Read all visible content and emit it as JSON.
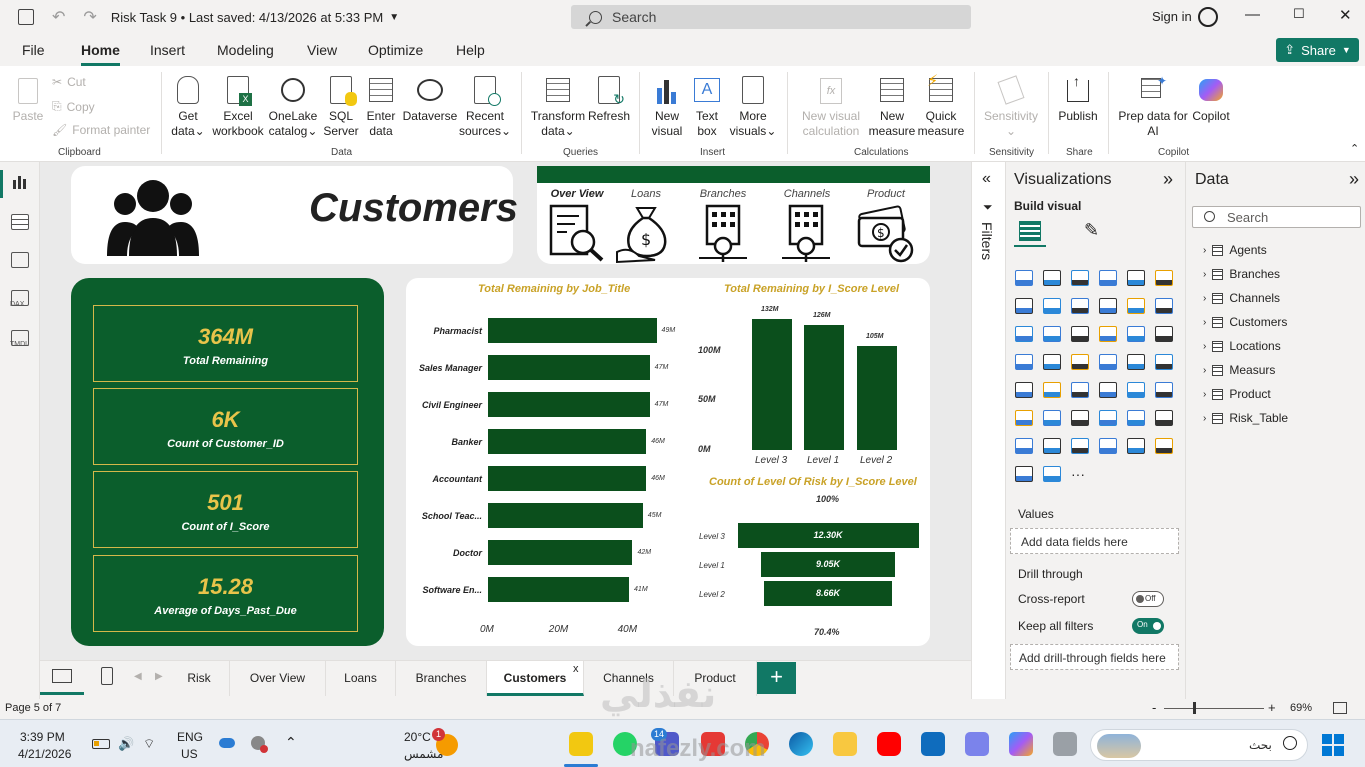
{
  "window": {
    "title": "Risk Task 9",
    "saved": "Last saved: 4/13/2026 at 5:33 PM",
    "search_placeholder": "Search",
    "sign_in": "Sign in"
  },
  "menu": {
    "tabs": [
      "File",
      "Home",
      "Insert",
      "Modeling",
      "View",
      "Optimize",
      "Help"
    ],
    "active": "Home",
    "share": "Share"
  },
  "ribbon": {
    "clipboard": {
      "paste": "Paste",
      "cut": "Cut",
      "copy": "Copy",
      "format_painter": "Format painter",
      "group": "Clipboard"
    },
    "data": {
      "get_data": [
        "Get",
        "data"
      ],
      "excel": [
        "Excel",
        "workbook"
      ],
      "onelake": [
        "OneLake",
        "catalog"
      ],
      "sql": [
        "SQL",
        "Server"
      ],
      "enter": [
        "Enter",
        "data"
      ],
      "dataverse": [
        "Dataverse",
        ""
      ],
      "recent": [
        "Recent",
        "sources"
      ],
      "group": "Data"
    },
    "queries": {
      "transform": [
        "Transform",
        "data"
      ],
      "refresh": [
        "Refresh",
        ""
      ],
      "group": "Queries"
    },
    "insert": {
      "new_visual": [
        "New",
        "visual"
      ],
      "text_box": [
        "Text",
        "box"
      ],
      "more_visuals": [
        "More",
        "visuals"
      ],
      "group": "Insert"
    },
    "calculations": {
      "new_visual_calc": [
        "New visual",
        "calculation"
      ],
      "new_measure": [
        "New",
        "measure"
      ],
      "quick_measure": [
        "Quick",
        "measure"
      ],
      "group": "Calculations"
    },
    "sensitivity": {
      "label": "Sensitivity",
      "group": "Sensitivity"
    },
    "share": {
      "publish": "Publish",
      "group": "Share"
    },
    "copilot": {
      "prep": [
        "Prep data for",
        "AI"
      ],
      "copilot": "Copilot",
      "group": "Copilot"
    }
  },
  "left_nav": {
    "dax": "DAX",
    "tmdl": "TMDL"
  },
  "report": {
    "title": "Customers",
    "nav": [
      "Over View",
      "Loans",
      "Branches",
      "Channels",
      "Product"
    ],
    "kpis": [
      {
        "value": "364M",
        "label": "Total Remaining"
      },
      {
        "value": "6K",
        "label": "Count of Customer_ID"
      },
      {
        "value": "501",
        "label": "Count of I_Score"
      },
      {
        "value": "15.28",
        "label": "Average of Days_Past_Due"
      }
    ]
  },
  "chart_data": [
    {
      "type": "bar",
      "orientation": "horizontal",
      "title": "Total Remaining by Job_Title",
      "categories": [
        "Pharmacist",
        "Sales Manager",
        "Civil Engineer",
        "Banker",
        "Accountant",
        "School Teac...",
        "Doctor",
        "Software En..."
      ],
      "values": [
        49,
        47,
        47,
        46,
        46,
        45,
        42,
        41
      ],
      "value_labels": [
        "49M",
        "47M",
        "47M",
        "46M",
        "46M",
        "45M",
        "42M",
        "41M"
      ],
      "x_ticks": [
        "0M",
        "20M",
        "40M"
      ],
      "xlim": [
        0,
        50
      ],
      "color": "#0b4f1c"
    },
    {
      "type": "bar",
      "title": "Total Remaining by I_Score Level",
      "categories": [
        "Level 3",
        "Level 1",
        "Level 2"
      ],
      "values": [
        132,
        126,
        105
      ],
      "value_labels": [
        "132M",
        "126M",
        "105M"
      ],
      "y_ticks": [
        "0M",
        "50M",
        "100M"
      ],
      "ylim": [
        0,
        132
      ],
      "color": "#0b4f1c"
    },
    {
      "type": "bar",
      "subtype": "funnel",
      "title": "Count of Level Of Risk by I_Score Level",
      "categories": [
        "Level 3",
        "Level 1",
        "Level 2"
      ],
      "values": [
        12300,
        9050,
        8660
      ],
      "value_labels": [
        "12.30K",
        "9.05K",
        "8.66K"
      ],
      "top_label": "100%",
      "bottom_label": "70.4%",
      "color": "#0b4f1c"
    }
  ],
  "viz_pane": {
    "title": "Visualizations",
    "build_visual": "Build visual",
    "values_label": "Values",
    "values_placeholder": "Add data fields here",
    "drill_through": "Drill through",
    "cross_report": "Cross-report",
    "cross_report_state": "Off",
    "keep_filters": "Keep all filters",
    "keep_filters_state": "On",
    "drill_placeholder": "Add drill-through fields here",
    "more": "···"
  },
  "filters_pane": {
    "label": "Filters"
  },
  "data_pane": {
    "title": "Data",
    "search_placeholder": "Search",
    "tables": [
      "Agents",
      "Branches",
      "Channels",
      "Customers",
      "Locations",
      "Measurs",
      "Product",
      "Risk_Table"
    ]
  },
  "pages": {
    "tabs": [
      "Risk",
      "Over View",
      "Loans",
      "Branches",
      "Customers",
      "Channels",
      "Product"
    ],
    "active": "Customers",
    "add": "+"
  },
  "status": {
    "page": "Page 5 of 7",
    "zoom": "69%",
    "minus": "-",
    "plus": "+"
  },
  "taskbar": {
    "time": "3:39 PM",
    "date": "4/21/2026",
    "lang1": "ENG",
    "lang2": "US",
    "temp": "20°C",
    "weather": "مشمس",
    "search": "بحث",
    "badge": "1",
    "badge2": "14"
  },
  "watermark": {
    "line1": "نفذلي",
    "line2": "nafezly.com"
  }
}
